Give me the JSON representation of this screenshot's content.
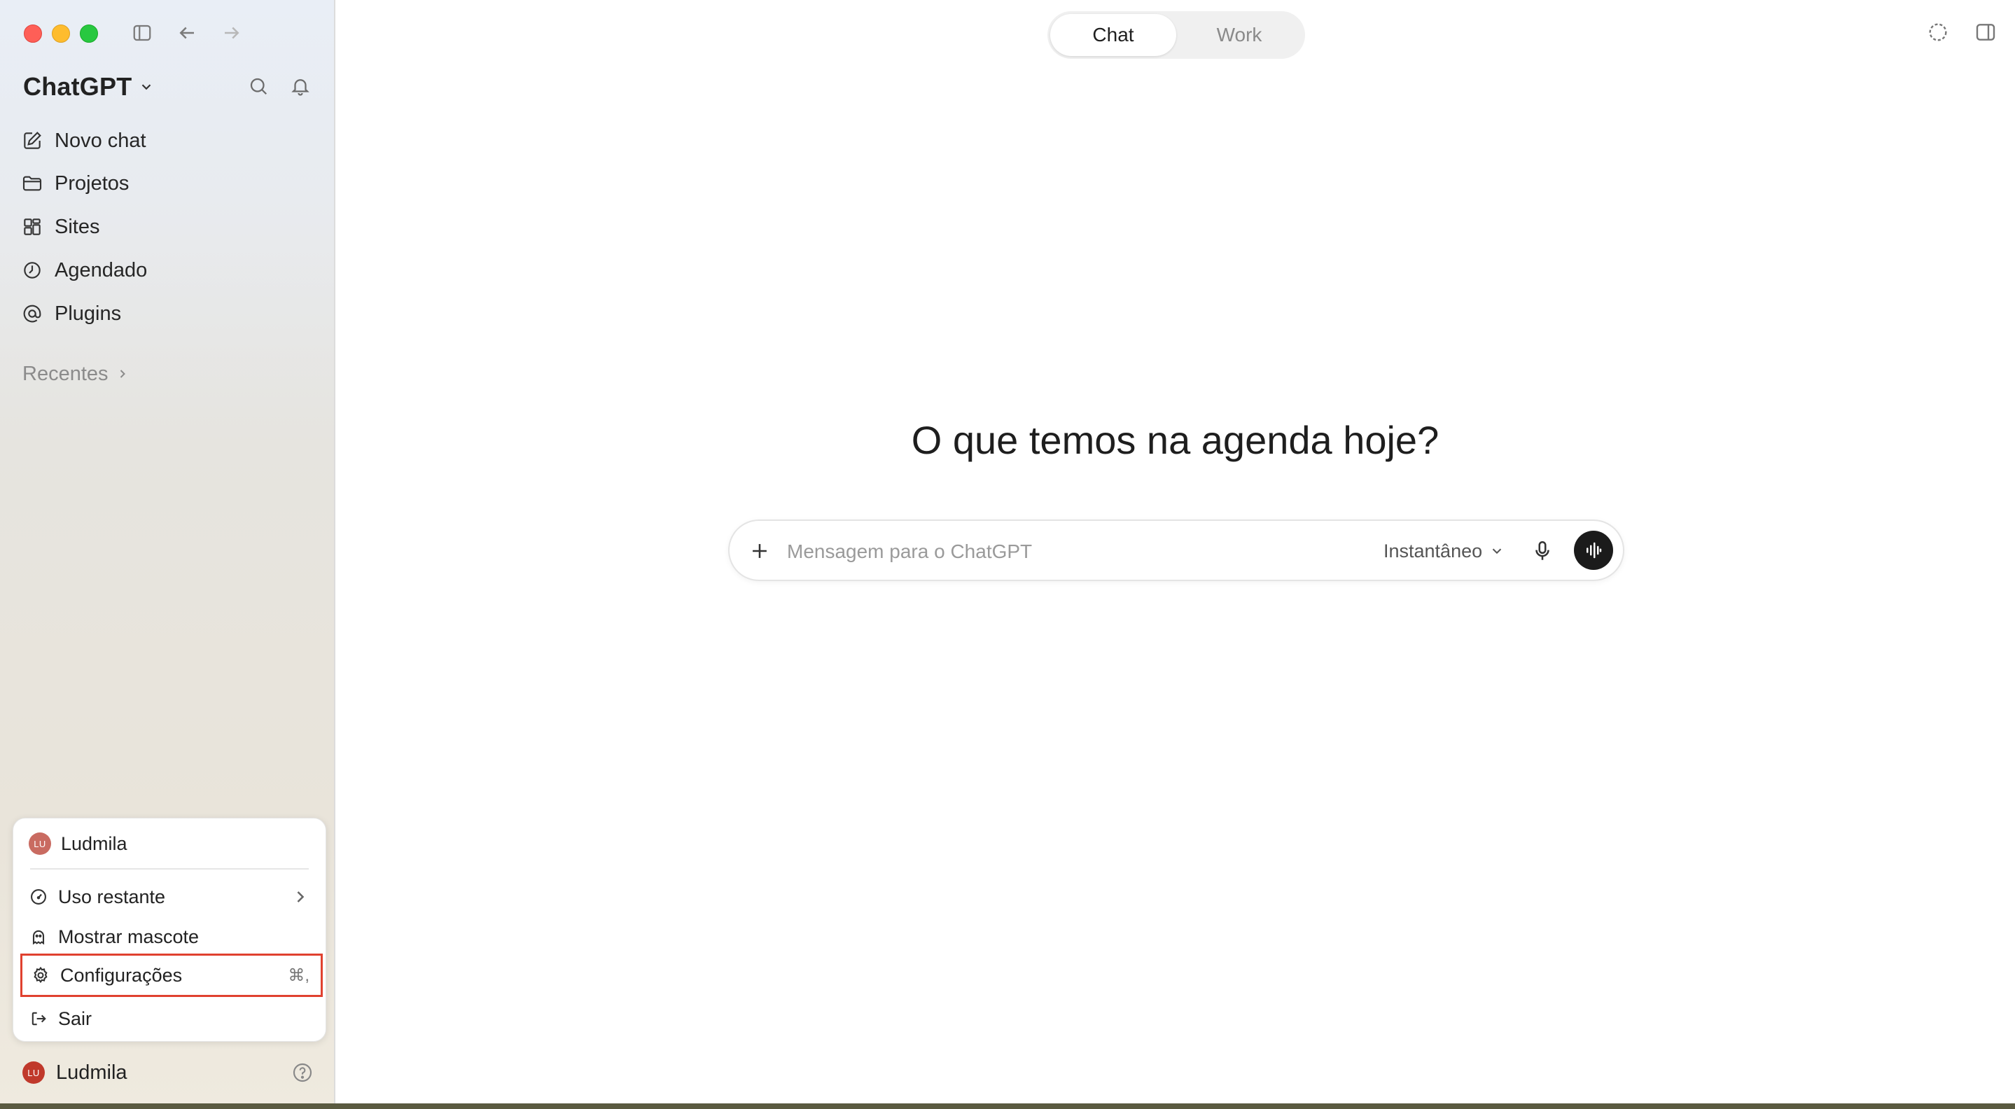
{
  "colors": {
    "accent_highlight": "#e0412f",
    "avatar_bg": "#c96b61",
    "voice_button": "#1b1b1b"
  },
  "sidebar": {
    "brand": "ChatGPT",
    "nav": [
      {
        "label": "Novo chat",
        "icon": "edit-icon"
      },
      {
        "label": "Projetos",
        "icon": "folder-icon"
      },
      {
        "label": "Sites",
        "icon": "grid-icon"
      },
      {
        "label": "Agendado",
        "icon": "clock-icon"
      },
      {
        "label": "Plugins",
        "icon": "at-icon"
      }
    ],
    "recent_label": "Recentes"
  },
  "user_menu": {
    "user_name": "Ludmila",
    "avatar_initials": "LU",
    "items": [
      {
        "label": "Uso restante",
        "icon": "gauge-icon"
      },
      {
        "label": "Mostrar mascote",
        "icon": "ghost-icon"
      },
      {
        "label": "Configurações",
        "icon": "gear-icon",
        "shortcut": "⌘,"
      },
      {
        "label": "Sair",
        "icon": "logout-icon"
      }
    ]
  },
  "bottom_user": {
    "name": "Ludmila",
    "avatar_initials": "LU"
  },
  "main": {
    "toggle": {
      "chat": "Chat",
      "work": "Work"
    },
    "heading": "O que temos na agenda hoje?",
    "composer": {
      "placeholder": "Mensagem para o ChatGPT",
      "model": "Instantâneo"
    }
  }
}
